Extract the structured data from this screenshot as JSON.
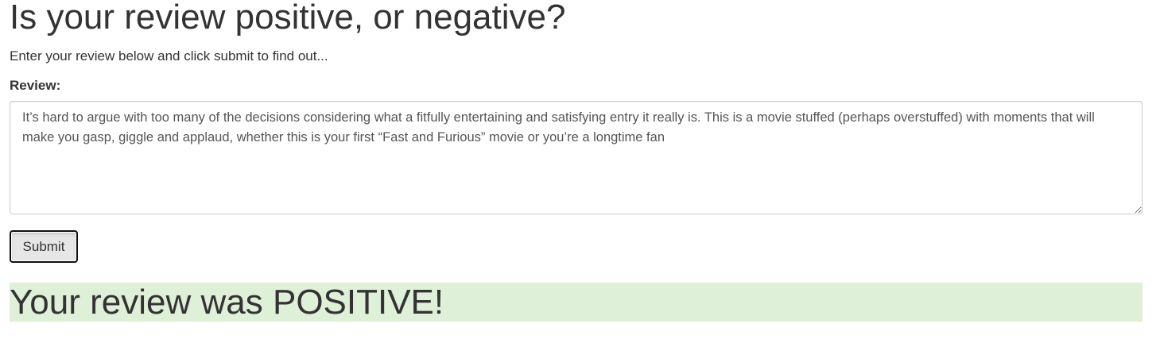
{
  "header": {
    "title": "Is your review positive, or negative?",
    "subtitle": "Enter your review below and click submit to find out..."
  },
  "form": {
    "review_label": "Review:",
    "review_value": "It’s hard to argue with too many of the decisions considering what a fitfully entertaining and satisfying entry it really is. This is a movie stuffed (perhaps overstuffed) with moments that will make you gasp, giggle and applaud, whether this is your first “Fast and Furious” movie or you’re a longtime fan",
    "submit_label": "Submit"
  },
  "result": {
    "text": "Your review was POSITIVE!",
    "status_color": "#dff0d8"
  }
}
